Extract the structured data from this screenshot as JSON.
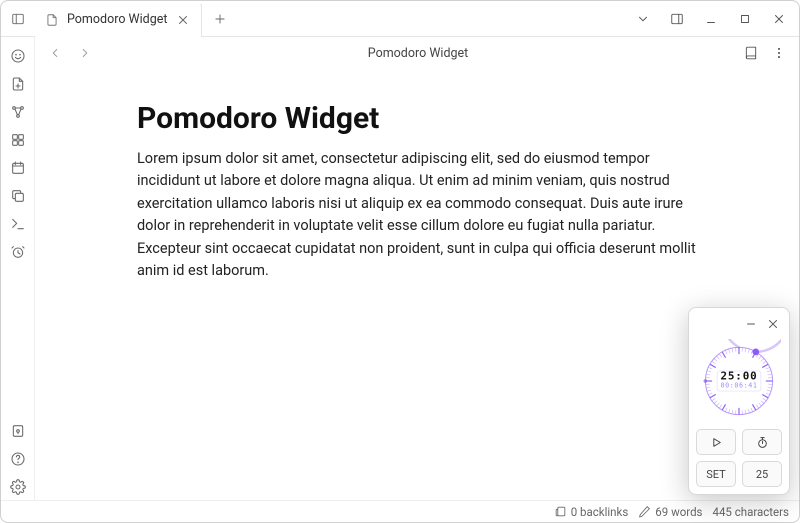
{
  "tab": {
    "title": "Pomodoro Widget"
  },
  "breadcrumb": "Pomodoro Widget",
  "document": {
    "heading": "Pomodoro Widget",
    "body": "Lorem ipsum dolor sit amet, consectetur adipiscing elit, sed do eiusmod tempor incididunt ut labore et dolore magna aliqua. Ut enim ad minim veniam, quis nostrud exercitation ullamco laboris nisi ut aliquip ex ea commodo consequat. Duis aute irure dolor in reprehenderit in voluptate velit esse cillum dolore eu fugiat nulla pariatur. Excepteur sint occaecat cupidatat non proident, sunt in culpa qui officia deserunt mollit anim id est laborum."
  },
  "pomodoro": {
    "time": "25:00",
    "elapsed": "00:06:41",
    "set_label": "SET",
    "minutes_label": "25",
    "accent": "#8b5cf6"
  },
  "status": {
    "backlinks": "0 backlinks",
    "words": "69 words",
    "chars": "445 characters"
  }
}
